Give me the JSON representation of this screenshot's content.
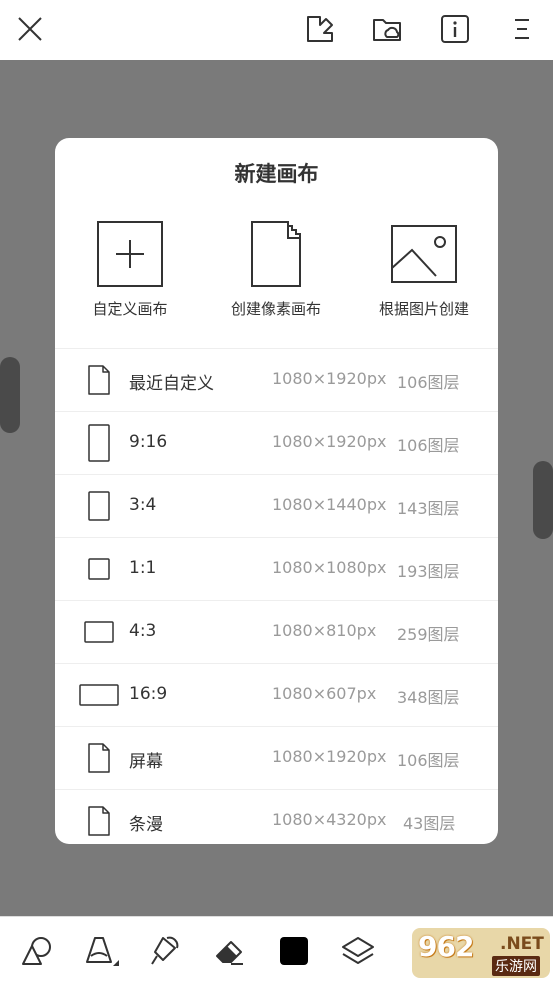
{
  "dialog": {
    "title": "新建画布",
    "options": [
      {
        "label": "自定义画布",
        "icon": "plus-square-icon"
      },
      {
        "label": "创建像素画布",
        "icon": "pixel-file-icon"
      },
      {
        "label": "根据图片创建",
        "icon": "image-icon"
      }
    ],
    "presets": [
      {
        "name": "最近自定义",
        "size": "1080×1920px",
        "layers": "106图层",
        "icon": "file-icon"
      },
      {
        "name": "9:16",
        "size": "1080×1920px",
        "layers": "106图层",
        "icon": "ratio-9-16-icon"
      },
      {
        "name": "3:4",
        "size": "1080×1440px",
        "layers": "143图层",
        "icon": "ratio-3-4-icon"
      },
      {
        "name": "1:1",
        "size": "1080×1080px",
        "layers": "193图层",
        "icon": "ratio-1-1-icon"
      },
      {
        "name": "4:3",
        "size": "1080×810px",
        "layers": "259图层",
        "icon": "ratio-4-3-icon"
      },
      {
        "name": "16:9",
        "size": "1080×607px",
        "layers": "348图层",
        "icon": "ratio-16-9-icon"
      },
      {
        "name": "屏幕",
        "size": "1080×1920px",
        "layers": "106图层",
        "icon": "file-icon"
      },
      {
        "name": "条漫",
        "size": "1080×4320px",
        "layers": "43图层",
        "icon": "file-icon"
      }
    ]
  },
  "topbar": {
    "icons": [
      "close-icon",
      "canvas-edit-icon",
      "folder-cloud-icon",
      "info-icon",
      "menu-icon"
    ]
  },
  "bottombar": {
    "icons": [
      "shapes-icon",
      "pencil-icon",
      "fill-bucket-icon",
      "eraser-icon",
      "color-swatch-icon",
      "layers-icon"
    ]
  },
  "watermark": {
    "number": "962",
    "suffix": ".NET",
    "sub": "乐游网"
  },
  "colors": {
    "overlay": "#7a7a7a",
    "text": "#333333",
    "muted": "#9a9a9a"
  }
}
